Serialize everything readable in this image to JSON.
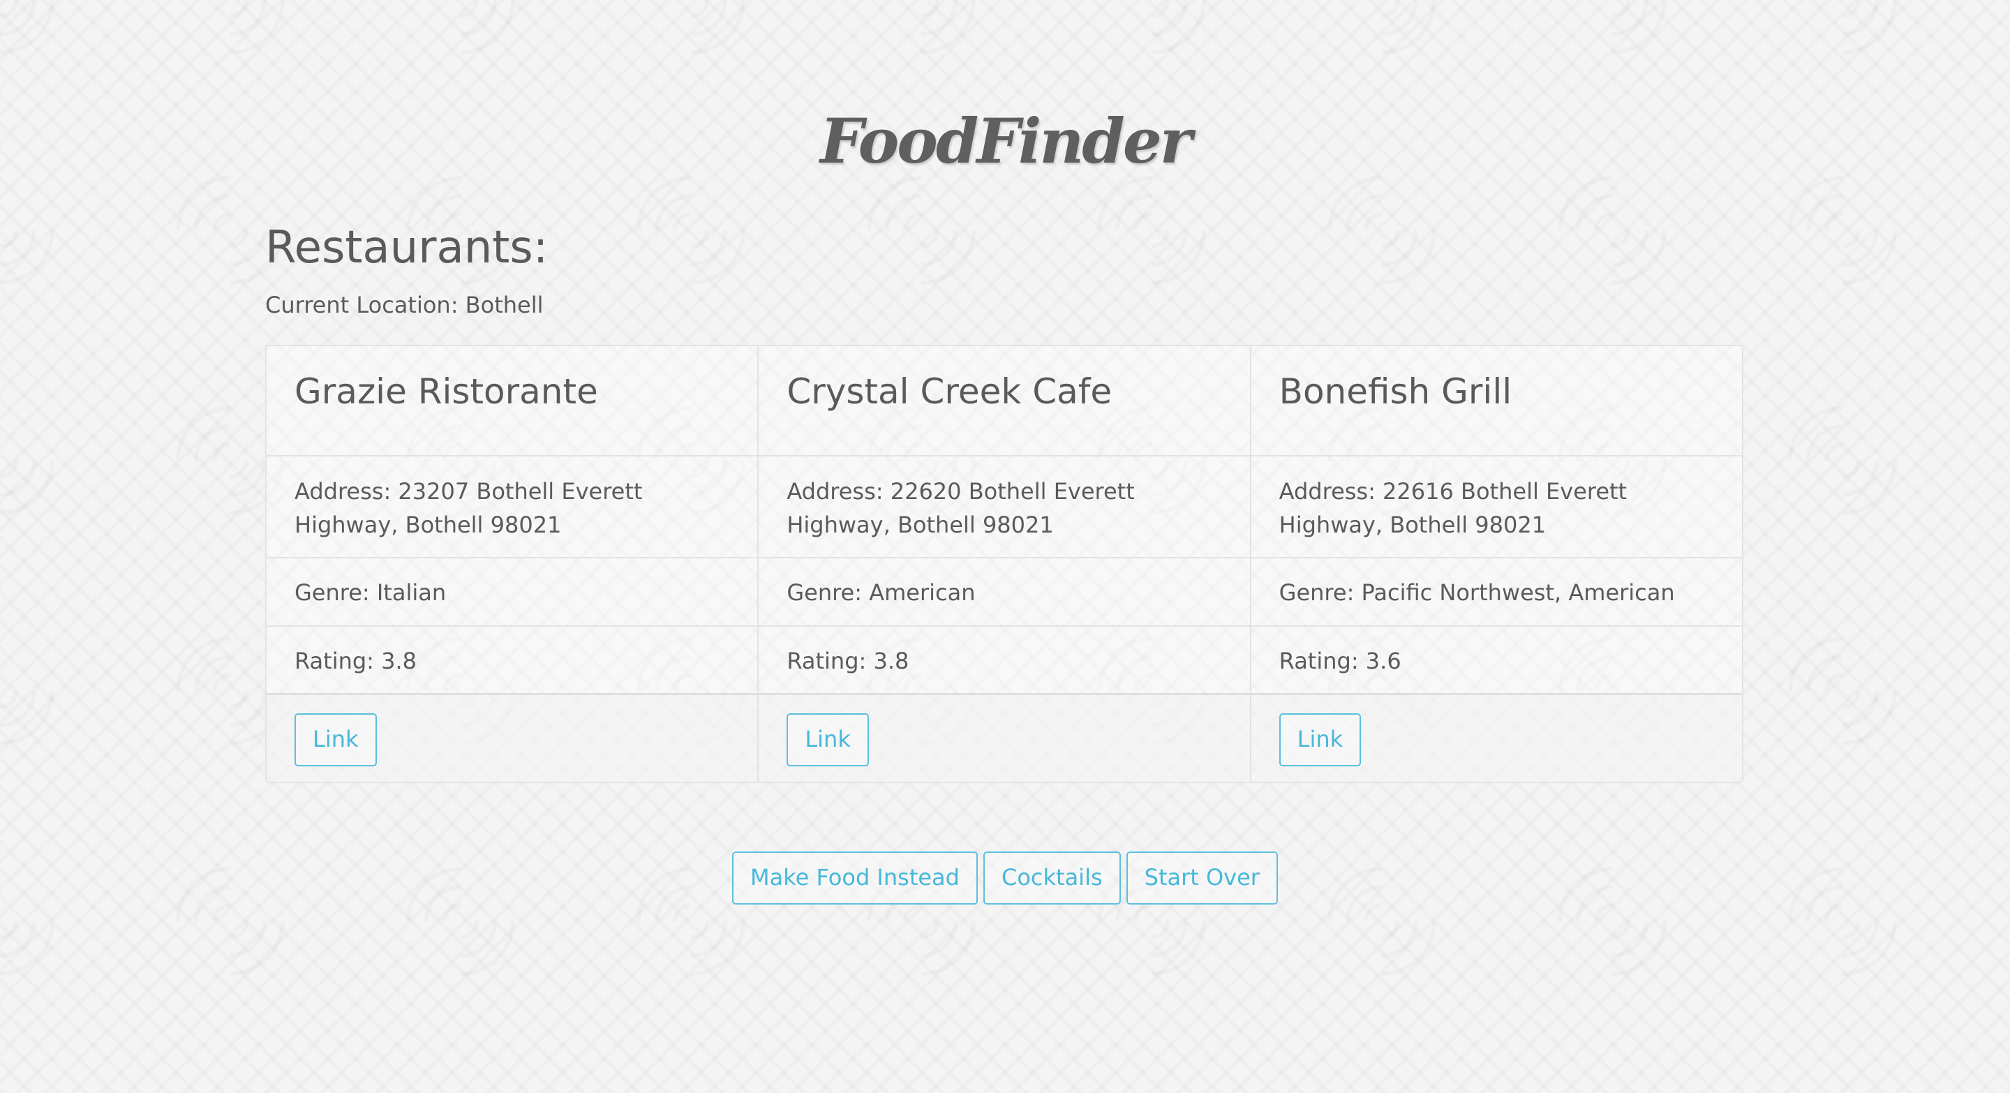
{
  "app": {
    "logo_text": "FoodFinder"
  },
  "main": {
    "heading": "Restaurants:",
    "location_text": "Current Location: Bothell"
  },
  "restaurants": [
    {
      "name": "Grazie Ristorante",
      "address": "Address: 23207 Bothell Everett Highway, Bothell 98021",
      "genre": "Genre: Italian",
      "rating": "Rating: 3.8",
      "link_label": "Link"
    },
    {
      "name": "Crystal Creek Cafe",
      "address": "Address: 22620 Bothell Everett Highway, Bothell 98021",
      "genre": "Genre: American",
      "rating": "Rating: 3.8",
      "link_label": "Link"
    },
    {
      "name": "Bonefish Grill",
      "address": "Address: 22616 Bothell Everett Highway, Bothell 98021",
      "genre": "Genre: Pacific Northwest, American",
      "rating": "Rating: 3.6",
      "link_label": "Link"
    }
  ],
  "actions": {
    "make_food_label": "Make Food Instead",
    "cocktails_label": "Cocktails",
    "start_over_label": "Start Over"
  },
  "colors": {
    "accent": "#5bc0de",
    "text": "#5a5a5a",
    "border": "#e3e3e3"
  }
}
